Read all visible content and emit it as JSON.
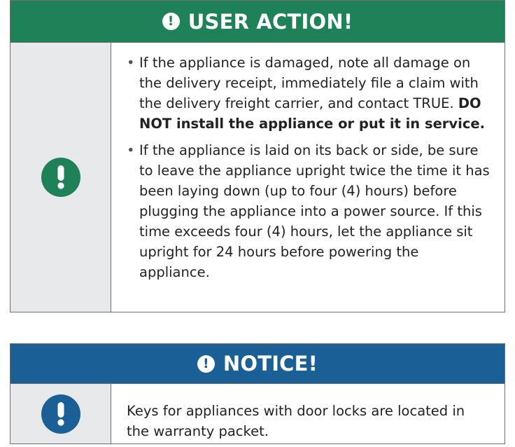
{
  "user_action": {
    "title": "USER ACTION!",
    "header_icon_glyph": "!",
    "header_color": "#1f8158",
    "bullets": [
      {
        "text": "If the appliance is damaged, note all damage on the delivery receipt, immediately file a claim with the delivery freight carrier, and contact TRUE.",
        "bold": "DO NOT install the appliance or put it in service."
      },
      {
        "text": "If the appliance is laid on its back or side, be sure to leave the appliance upright twice the time it has been laying down (up to four (4) hours) before plugging the appliance into a power source. If this time exceeds four (4) hours, let the appliance sit upright for 24 hours before powering the appliance."
      }
    ],
    "bullet_glyph": "•"
  },
  "notice": {
    "title": "NOTICE!",
    "header_icon_glyph": "!",
    "header_color": "#1a6096",
    "text": "Keys for appliances with door locks are located in the warranty packet."
  },
  "icons": {
    "header": "exclamation-circle-icon",
    "body": "exclamation-circle-icon"
  }
}
